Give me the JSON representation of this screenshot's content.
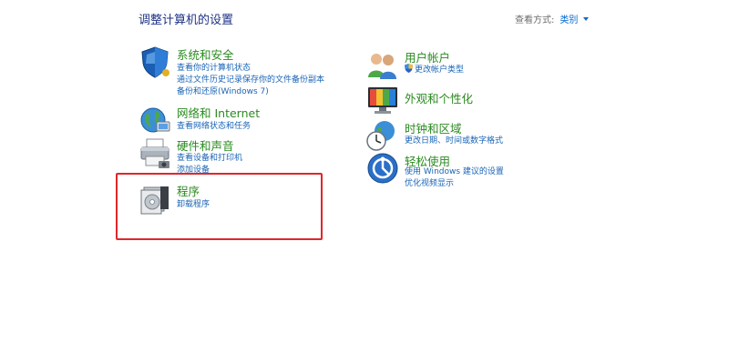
{
  "header": {
    "title": "调整计算机的设置",
    "view_by_label": "查看方式:",
    "view_by_value": "类别"
  },
  "left_column": [
    {
      "title": "系统和安全",
      "icon": "shield-icon",
      "links": [
        "查看你的计算机状态",
        "通过文件历史记录保存你的文件备份副本",
        "备份和还原(Windows 7)"
      ]
    },
    {
      "title": "网络和 Internet",
      "icon": "network-globe-icon",
      "links": [
        "查看网络状态和任务"
      ]
    },
    {
      "title": "硬件和声音",
      "icon": "printer-icon",
      "links": [
        "查看设备和打印机",
        "添加设备"
      ]
    },
    {
      "title": "程序",
      "icon": "programs-disc-icon",
      "links": [
        "卸载程序"
      ]
    }
  ],
  "right_column": [
    {
      "title": "用户帐户",
      "icon": "user-accounts-icon",
      "links": [
        "更改帐户类型"
      ]
    },
    {
      "title": "外观和个性化",
      "icon": "appearance-monitor-icon",
      "links": []
    },
    {
      "title": "时钟和区域",
      "icon": "clock-globe-icon",
      "links": [
        "更改日期、时间或数字格式"
      ]
    },
    {
      "title": "轻松使用",
      "icon": "accessibility-icon",
      "links": [
        "使用 Windows 建议的设置",
        "优化视频显示"
      ]
    }
  ],
  "colors": {
    "category_title": "#2a8a1f",
    "link": "#1a64b6",
    "highlight": "#e0262a"
  }
}
